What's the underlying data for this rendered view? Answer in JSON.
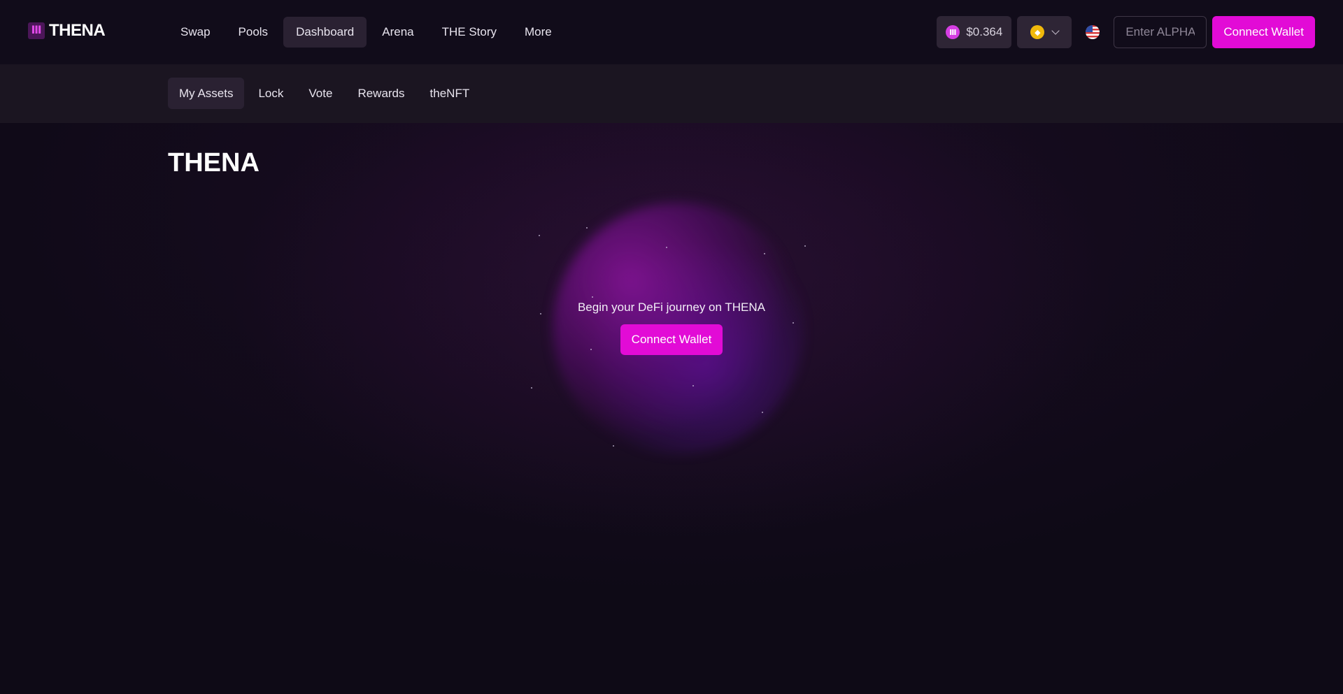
{
  "brand": {
    "name": "THENA",
    "logo_glyph": "Ⅲ"
  },
  "nav": {
    "items": [
      {
        "label": "Swap"
      },
      {
        "label": "Pools"
      },
      {
        "label": "Dashboard",
        "active": true
      },
      {
        "label": "Arena"
      },
      {
        "label": "THE Story"
      },
      {
        "label": "More"
      }
    ]
  },
  "toolbar": {
    "price": "$0.364",
    "price_icon": "thena-token-icon",
    "chain_icon": "bnb-chain-icon",
    "language_icon": "us-flag-icon",
    "alpha_placeholder": "Enter ALPHA",
    "connect_label": "Connect Wallet"
  },
  "subnav": {
    "items": [
      {
        "label": "My Assets",
        "active": true
      },
      {
        "label": "Lock"
      },
      {
        "label": "Vote"
      },
      {
        "label": "Rewards"
      },
      {
        "label": "theNFT"
      }
    ]
  },
  "main": {
    "title": "THENA",
    "hero_text": "Begin your DeFi journey on THENA",
    "hero_button": "Connect Wallet"
  },
  "colors": {
    "accent": "#e20bd6",
    "background": "#0e0a16",
    "topbar": "#110c1a",
    "subbar": "#1b1521"
  }
}
